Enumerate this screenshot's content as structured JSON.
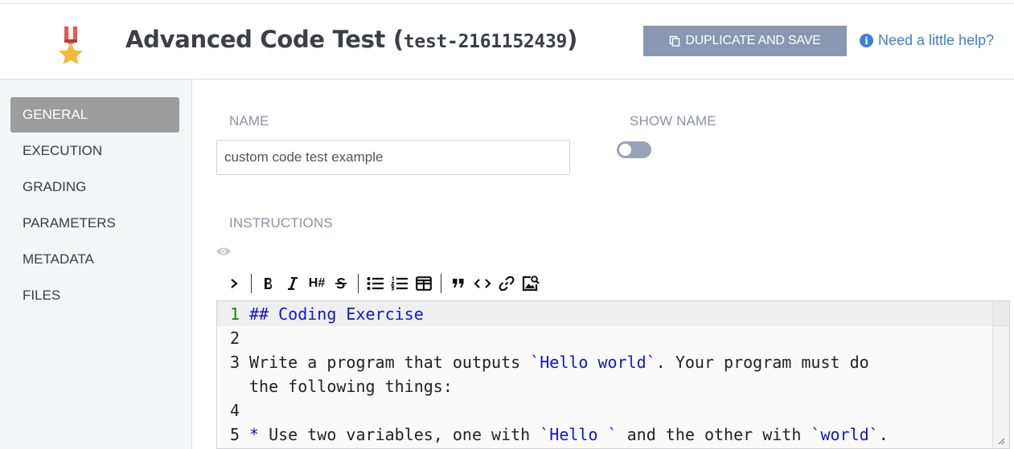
{
  "header": {
    "title": "Advanced Code Test",
    "test_id": "test-2161152439",
    "duplicate_button": "DUPLICATE AND SAVE",
    "help_link": "Need a little help?"
  },
  "sidebar": {
    "items": [
      {
        "label": "GENERAL",
        "active": true
      },
      {
        "label": "EXECUTION",
        "active": false
      },
      {
        "label": "GRADING",
        "active": false
      },
      {
        "label": "PARAMETERS",
        "active": false
      },
      {
        "label": "METADATA",
        "active": false
      },
      {
        "label": "FILES",
        "active": false
      }
    ]
  },
  "form": {
    "name_label": "NAME",
    "name_value": "custom code test example",
    "show_name_label": "SHOW NAME",
    "show_name_enabled": false,
    "instructions_label": "INSTRUCTIONS"
  },
  "toolbar": {
    "buttons": [
      "expand",
      "bold",
      "italic",
      "heading",
      "strikethrough",
      "bullet-list",
      "numbered-list",
      "table",
      "quote",
      "code",
      "link",
      "image"
    ],
    "heading_glyph": "H#"
  },
  "editor": {
    "lines": [
      {
        "num": "1",
        "parts": [
          {
            "t": "## Coding Exercise",
            "c": "hdr"
          }
        ]
      },
      {
        "num": "2",
        "parts": []
      },
      {
        "num": "3",
        "parts": [
          {
            "t": "Write a program that outputs ",
            "c": ""
          },
          {
            "t": "`Hello world`",
            "c": "code"
          },
          {
            "t": ". Your program must do",
            "c": ""
          }
        ]
      },
      {
        "num": "",
        "parts": [
          {
            "t": "the following things:",
            "c": ""
          }
        ]
      },
      {
        "num": "4",
        "parts": []
      },
      {
        "num": "5",
        "parts": [
          {
            "t": "*",
            "c": "code"
          },
          {
            "t": " Use two variables, one with ",
            "c": ""
          },
          {
            "t": "`Hello `",
            "c": "code"
          },
          {
            "t": " and the other with ",
            "c": ""
          },
          {
            "t": "`world`",
            "c": "code"
          },
          {
            "t": ".",
            "c": ""
          }
        ]
      }
    ]
  },
  "colors": {
    "accent": "#8a97b2",
    "link": "#3d7fd6",
    "active_nav": "#9c9c9c",
    "markdown_token": "#1515c8"
  }
}
